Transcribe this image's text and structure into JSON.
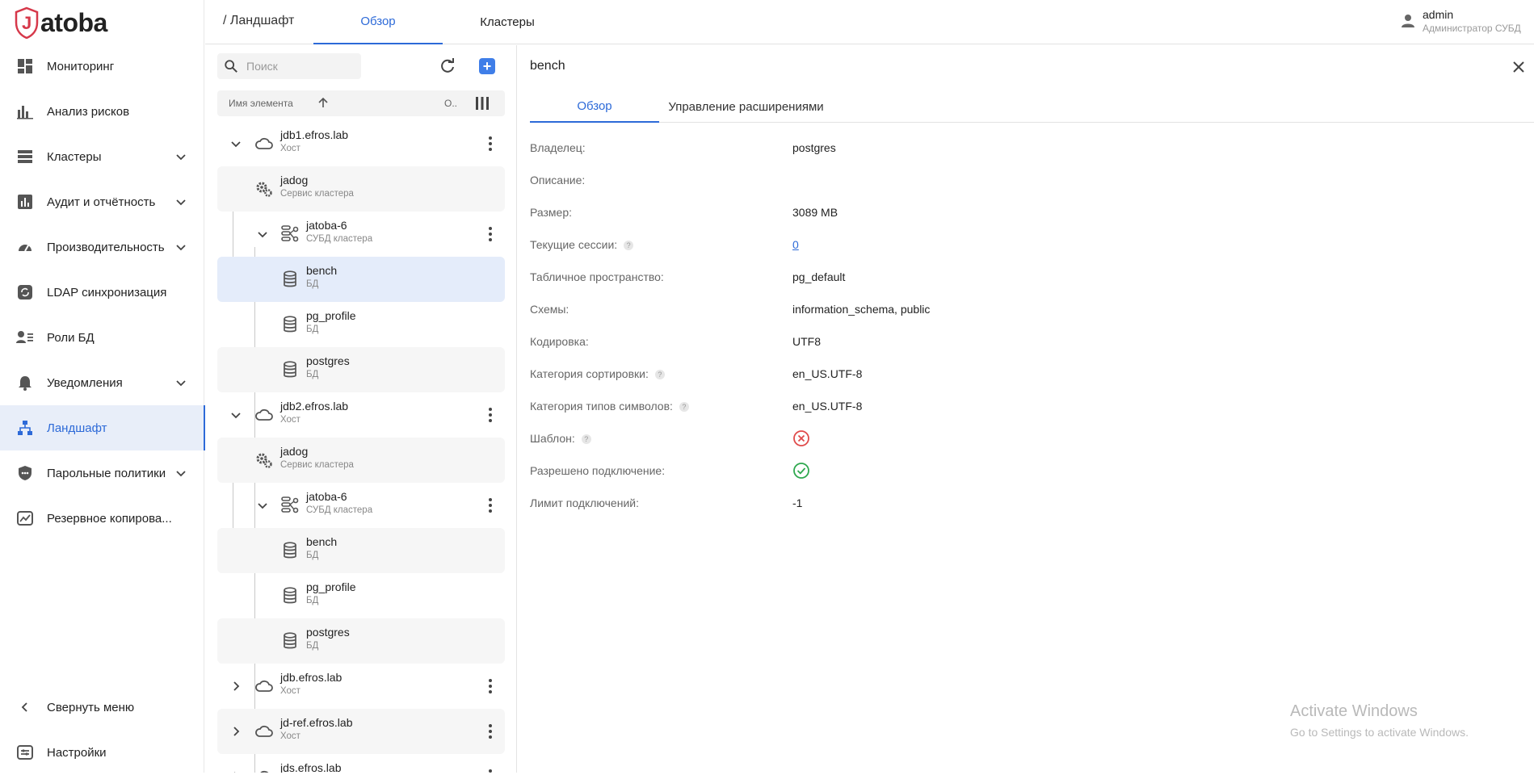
{
  "app": {
    "logo_text": "Jatoba",
    "brand_color": "#d6384a",
    "accent": "#2d6ad8"
  },
  "sidebar": {
    "items": [
      {
        "label": "Мониторинг",
        "icon": "dashboard-icon",
        "has_chevron": false
      },
      {
        "label": "Анализ рисков",
        "icon": "analytics-icon",
        "has_chevron": false
      },
      {
        "label": "Кластеры",
        "icon": "storage-icon",
        "has_chevron": true
      },
      {
        "label": "Аудит и отчётность",
        "icon": "bar-chart-icon",
        "has_chevron": true
      },
      {
        "label": "Производительность",
        "icon": "speed-icon",
        "has_chevron": true
      },
      {
        "label": "LDAP синхронизация",
        "icon": "sync-icon",
        "has_chevron": false
      },
      {
        "label": "Роли БД",
        "icon": "people-icon",
        "has_chevron": false
      },
      {
        "label": "Уведомления",
        "icon": "bell-icon",
        "has_chevron": true
      },
      {
        "label": "Ландшафт",
        "icon": "hierarchy-icon",
        "has_chevron": false,
        "active": true
      },
      {
        "label": "Парольные политики",
        "icon": "shield-icon",
        "has_chevron": true
      },
      {
        "label": "Резервное копирова...",
        "icon": "backup-icon",
        "has_chevron": false
      }
    ],
    "collapse_label": "Свернуть меню",
    "settings_label": "Настройки"
  },
  "header": {
    "breadcrumb": "/ Ландшафт",
    "tabs": [
      {
        "label": "Обзор",
        "active": true
      },
      {
        "label": "Кластеры",
        "active": false
      }
    ],
    "user": {
      "name": "admin",
      "role": "Администратор СУБД"
    }
  },
  "tree": {
    "search_placeholder": "Поиск",
    "column_name": "Имя элемента",
    "column_short": "О..",
    "rows": [
      {
        "name": "jdb1.efros.lab",
        "type": "Хост"
      },
      {
        "name": "jadog",
        "type": "Сервис кластера"
      },
      {
        "name": "jatoba-6",
        "type": "СУБД кластера"
      },
      {
        "name": "bench",
        "type": "БД"
      },
      {
        "name": "pg_profile",
        "type": "БД"
      },
      {
        "name": "postgres",
        "type": "БД"
      },
      {
        "name": "jdb2.efros.lab",
        "type": "Хост"
      },
      {
        "name": "jadog",
        "type": "Сервис кластера"
      },
      {
        "name": "jatoba-6",
        "type": "СУБД кластера"
      },
      {
        "name": "bench",
        "type": "БД"
      },
      {
        "name": "pg_profile",
        "type": "БД"
      },
      {
        "name": "postgres",
        "type": "БД"
      },
      {
        "name": "jdb.efros.lab",
        "type": "Хост"
      },
      {
        "name": "jd-ref.efros.lab",
        "type": "Хост"
      },
      {
        "name": "jds.efros.lab",
        "type": ""
      }
    ]
  },
  "detail": {
    "title": "bench",
    "tabs": [
      {
        "label": "Обзор",
        "active": true
      },
      {
        "label": "Управление расширениями",
        "active": false
      }
    ],
    "props": [
      {
        "label": "Владелец:",
        "value": "postgres"
      },
      {
        "label": "Описание:",
        "value": ""
      },
      {
        "label": "Размер:",
        "value": "3089 MB"
      },
      {
        "label": "Текущие сессии:",
        "value": "0",
        "help": true,
        "link": true
      },
      {
        "label": "Табличное пространство:",
        "value": "pg_default"
      },
      {
        "label": "Схемы:",
        "value": "information_schema, public"
      },
      {
        "label": "Кодировка:",
        "value": "UTF8"
      },
      {
        "label": "Категория сортировки:",
        "value": "en_US.UTF-8",
        "help": true
      },
      {
        "label": "Категория типов символов:",
        "value": "en_US.UTF-8",
        "help": true
      },
      {
        "label": "Шаблон:",
        "value": "",
        "help": true,
        "icon": "cancel-circle-icon",
        "icon_color": "#e04b4b"
      },
      {
        "label": "Разрешено подключение:",
        "value": "",
        "icon": "check-circle-icon",
        "icon_color": "#2fa84f"
      },
      {
        "label": "Лимит подключений:",
        "value": "-1"
      }
    ]
  },
  "watermark": {
    "line1": "Activate Windows",
    "line2": "Go to Settings to activate Windows."
  }
}
